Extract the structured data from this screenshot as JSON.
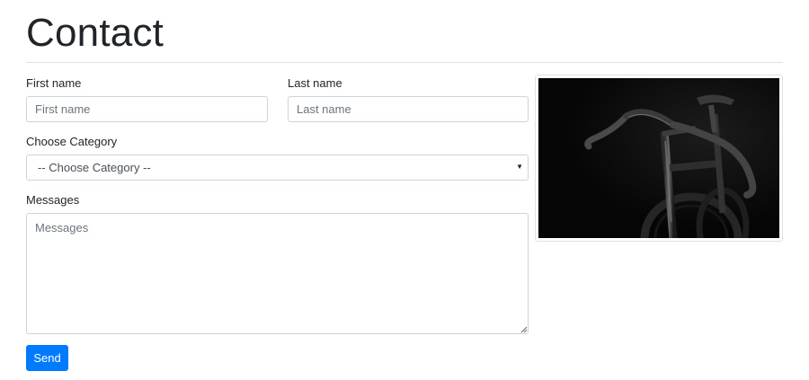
{
  "page": {
    "title": "Contact"
  },
  "form": {
    "first_name": {
      "label": "First name",
      "placeholder": "First name",
      "value": ""
    },
    "last_name": {
      "label": "Last name",
      "placeholder": "Last name",
      "value": ""
    },
    "category": {
      "label": "Choose Category",
      "selected": "-- Choose Category --",
      "arrow_icon": "caret-down-icon"
    },
    "messages": {
      "label": "Messages",
      "placeholder": "Messages",
      "value": ""
    },
    "send_label": "Send"
  },
  "image": {
    "subject": "black road bicycle on dark background",
    "icon": "bicycle-photo"
  },
  "colors": {
    "primary": "#007bff",
    "border": "#ced4da",
    "divider": "#dee2e6",
    "text": "#212529",
    "placeholder": "#6c757d",
    "photo_bg": "#0a0a0a"
  }
}
